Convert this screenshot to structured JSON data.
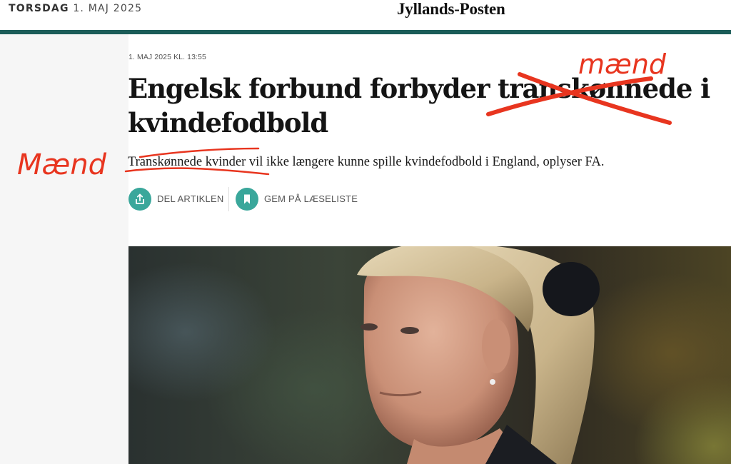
{
  "header": {
    "date_day": "TORSDAG",
    "date_rest": "1. MAJ 2025",
    "logo": "Jyllands-Posten"
  },
  "article": {
    "meta": "1. MAJ 2025 KL. 13:55",
    "headline_line1": "Engelsk forbund forbyder transkønnede i",
    "headline_line2": "kvindefodbold",
    "lead": "Transkønnede kvinder vil ikke længere kunne spille kvindefodbold i England, oplyser FA.",
    "actions": [
      {
        "label": "DEL ARTIKLEN",
        "icon": "share-icon"
      },
      {
        "label": "GEM PÅ LÆSELISTE",
        "icon": "bookmark-icon"
      }
    ]
  },
  "annotations": {
    "headline_replacement": "mænd",
    "lead_replacement": "Mænd",
    "ink_color": "#e8351f"
  },
  "colors": {
    "rule": "#1b5c58",
    "action_circle": "#3aa79b"
  }
}
